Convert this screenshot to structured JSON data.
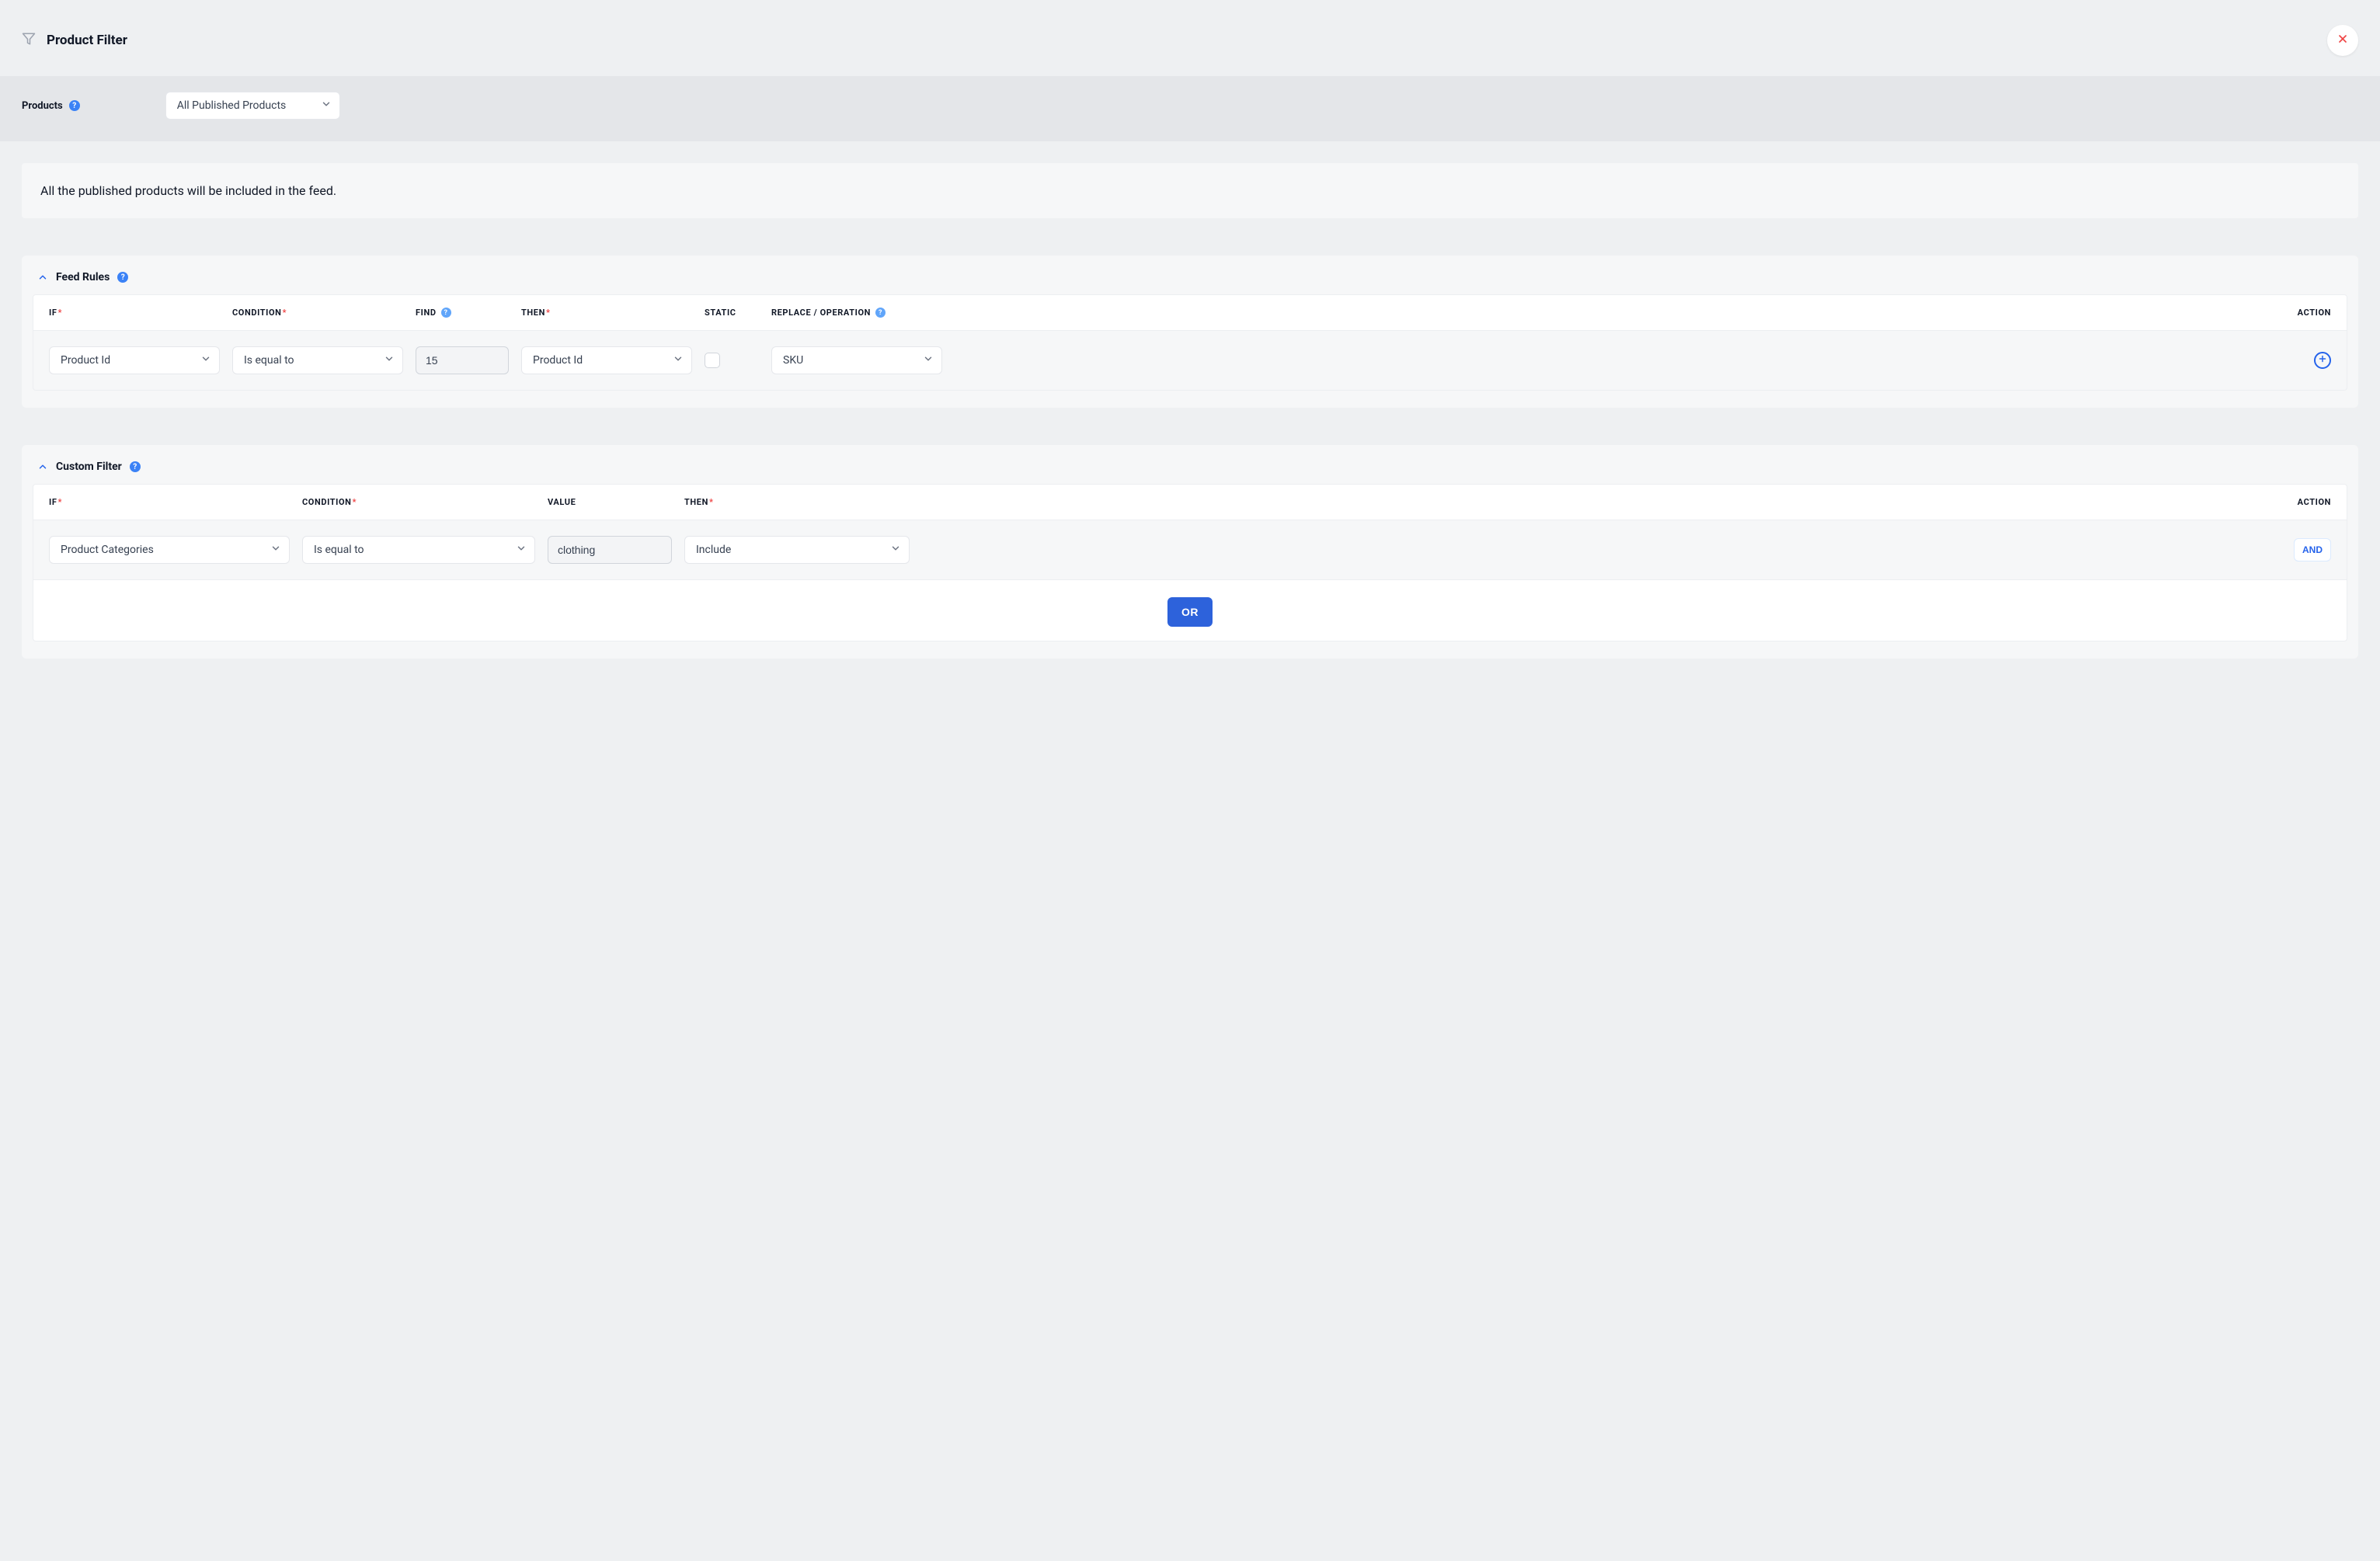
{
  "header": {
    "title": "Product Filter"
  },
  "products": {
    "label": "Products",
    "selected": "All Published Products"
  },
  "notice": "All the published products will be included in the feed.",
  "feedRules": {
    "title": "Feed Rules",
    "columns": {
      "if": "IF",
      "condition": "CONDITION",
      "find": "FIND",
      "then": "THEN",
      "static": "STATIC",
      "replace": "REPLACE / OPERATION",
      "action": "ACTION"
    },
    "row": {
      "if": "Product Id",
      "condition": "Is equal to",
      "findValue": "15",
      "then": "Product Id",
      "replace": "SKU"
    }
  },
  "customFilter": {
    "title": "Custom Filter",
    "columns": {
      "if": "IF",
      "condition": "CONDITION",
      "value": "VALUE",
      "then": "THEN",
      "action": "ACTION"
    },
    "row": {
      "if": "Product Categories",
      "condition": "Is equal to",
      "value": "clothing",
      "then": "Include"
    },
    "andLabel": "AND",
    "orLabel": "OR"
  }
}
